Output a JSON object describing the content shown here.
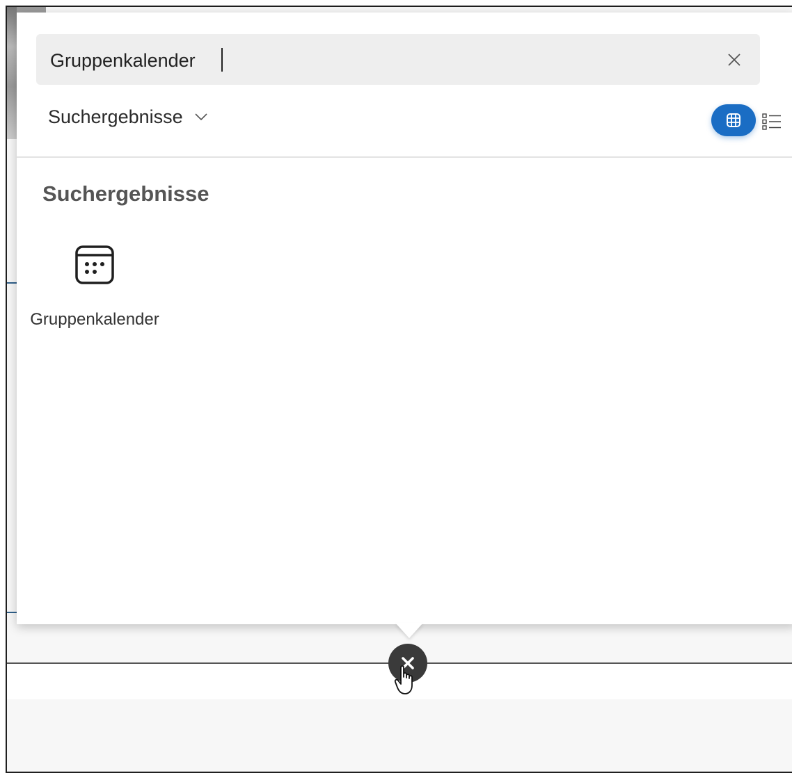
{
  "search": {
    "value": "Gruppenkalender",
    "clear_icon": "close-icon"
  },
  "scope": {
    "label": "Suchergebnisse",
    "icon": "chevron-down-icon"
  },
  "view_toggle": {
    "active": "grid",
    "grid_icon": "grid-view-icon",
    "list_icon": "list-view-icon",
    "accent_color": "#1a6dc4"
  },
  "results": {
    "heading": "Suchergebnisse",
    "items": [
      {
        "label": "Gruppenkalender",
        "icon": "calendar-icon"
      }
    ]
  },
  "close_fab": {
    "icon": "close-icon",
    "color": "#3a3a3a"
  }
}
